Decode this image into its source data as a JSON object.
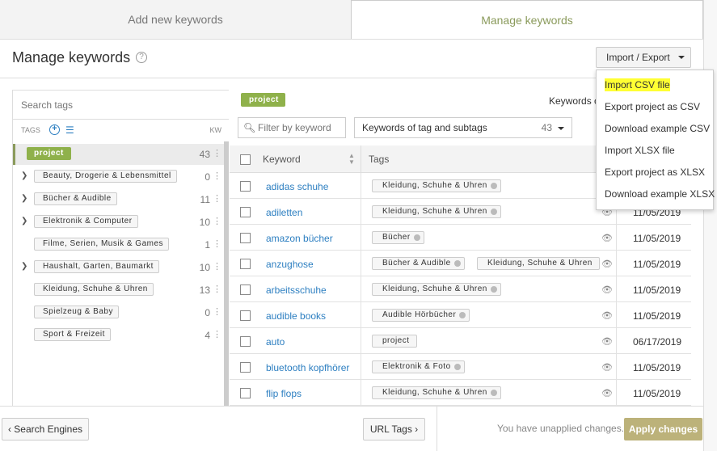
{
  "tabs": {
    "add": "Add new keywords",
    "manage": "Manage keywords"
  },
  "header": {
    "title": "Manage keywords",
    "help": "?"
  },
  "import_export": {
    "label": "Import / Export",
    "menu": [
      "Import CSV file",
      "Export project as CSV",
      "Download example CSV",
      "Import XLSX file",
      "Export project as XLSX",
      "Download example XLSX"
    ]
  },
  "sidebar": {
    "search_placeholder": "Search tags",
    "tags_label": "TAGS",
    "kw_label": "KW",
    "dots": "⋮",
    "items": [
      {
        "label": "project",
        "count": "43"
      },
      {
        "label": "Beauty, Drogerie & Lebensmittel",
        "count": "0"
      },
      {
        "label": "Bücher & Audible",
        "count": "11"
      },
      {
        "label": "Elektronik & Computer",
        "count": "10"
      },
      {
        "label": "Filme, Serien, Musik & Games",
        "count": "1"
      },
      {
        "label": "Haushalt, Garten, Baumarkt",
        "count": "10"
      },
      {
        "label": "Kleidung, Schuhe & Uhren",
        "count": "13"
      },
      {
        "label": "Spielzeug & Baby",
        "count": "0"
      },
      {
        "label": "Sport & Freizeit",
        "count": "4"
      }
    ]
  },
  "main": {
    "project_chip": "project",
    "keywords_count_label": "Keywords o",
    "filter_placeholder": "Filter by keyword",
    "select": {
      "label": "Keywords of tag and subtags",
      "count": "43"
    },
    "table": {
      "col_keyword": "Keyword",
      "col_tags": "Tags",
      "rows": [
        {
          "keyword": "adidas schuhe",
          "tags": [
            "Kleidung, Schuhe & Uhren"
          ],
          "date": ""
        },
        {
          "keyword": "adiletten",
          "tags": [
            "Kleidung, Schuhe & Uhren"
          ],
          "date": "11/05/2019"
        },
        {
          "keyword": "amazon bücher",
          "tags": [
            "Bücher"
          ],
          "date": "11/05/2019"
        },
        {
          "keyword": "anzughose",
          "tags": [
            "Bücher & Audible",
            "Kleidung, Schuhe & Uhren"
          ],
          "date": "11/05/2019"
        },
        {
          "keyword": "arbeitsschuhe",
          "tags": [
            "Kleidung, Schuhe & Uhren"
          ],
          "date": "11/05/2019"
        },
        {
          "keyword": "audible books",
          "tags": [
            "Audible Hörbücher"
          ],
          "date": "11/05/2019"
        },
        {
          "keyword": "auto",
          "tags": [
            "project"
          ],
          "date": "06/17/2019"
        },
        {
          "keyword": "bluetooth kopfhörer",
          "tags": [
            "Elektronik & Foto"
          ],
          "date": "11/05/2019"
        },
        {
          "keyword": "flip flops",
          "tags": [
            "Kleidung, Schuhe & Uhren"
          ],
          "date": "11/05/2019"
        }
      ]
    }
  },
  "footer": {
    "search_engines": "‹ Search Engines",
    "url_tags": "URL Tags ›",
    "unapplied": "You have unapplied changes.",
    "apply": "Apply changes"
  },
  "colors": {
    "accent_green": "#8fb14b",
    "link_blue": "#2d7fc1",
    "apply_bg": "#bcb27a",
    "highlight": "#ffff33"
  }
}
